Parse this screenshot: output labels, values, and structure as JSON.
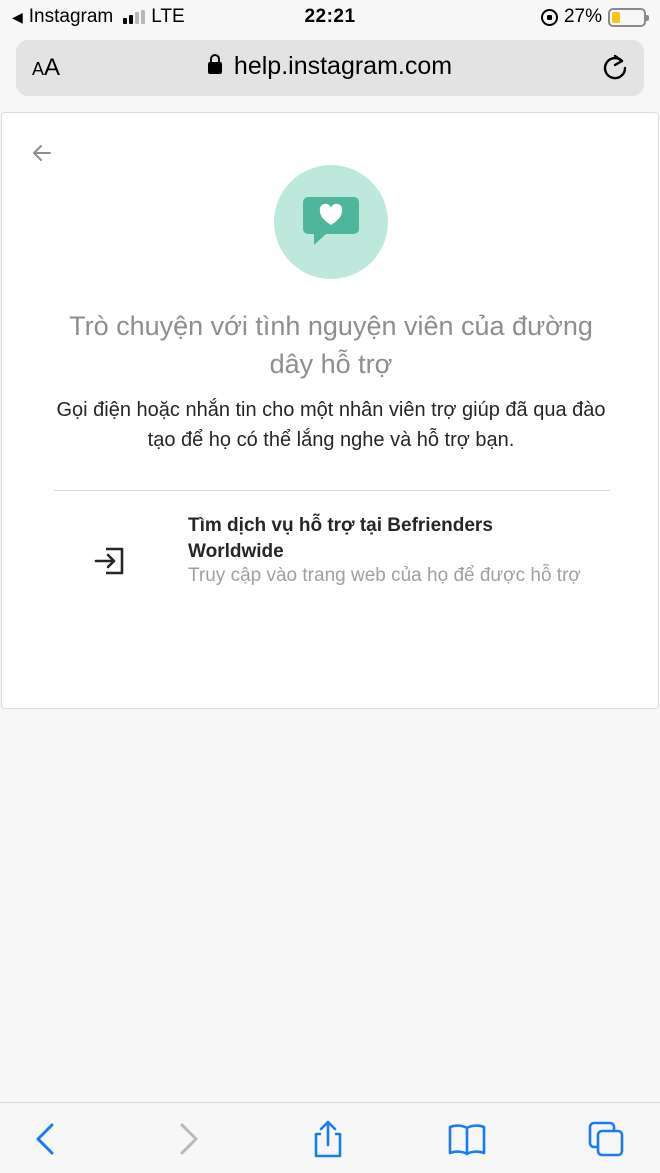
{
  "status_bar": {
    "back_app": "Instagram",
    "network": "LTE",
    "time": "22:21",
    "battery_percent": "27%",
    "battery_level": 0.27,
    "signal_bars": 2
  },
  "url_bar": {
    "text_size_label_small": "A",
    "text_size_label_large": "A",
    "domain": "help.instagram.com"
  },
  "card": {
    "hero_icon": "chat-heart-icon",
    "title": "Trò chuyện với tình nguyện viên của đường dây hỗ trợ",
    "description": "Gọi điện hoặc nhắn tin cho một nhân viên trợ giúp đã qua đào tạo để họ có thể lắng nghe và hỗ trợ bạn.",
    "option": {
      "icon": "exit-arrow-icon",
      "title": "Tìm dịch vụ hỗ trợ tại Befrienders Worldwide",
      "subtitle": "Truy cập vào trang web của họ để được hỗ trợ"
    }
  },
  "toolbar": {
    "items": [
      "back-icon",
      "forward-icon",
      "share-icon",
      "bookmarks-icon",
      "tabs-icon"
    ]
  },
  "colors": {
    "accent_blue": "#1a7cf5",
    "hero_circle": "#bfe8dd",
    "hero_icon": "#4fb69b",
    "battery": "#f5c518"
  }
}
